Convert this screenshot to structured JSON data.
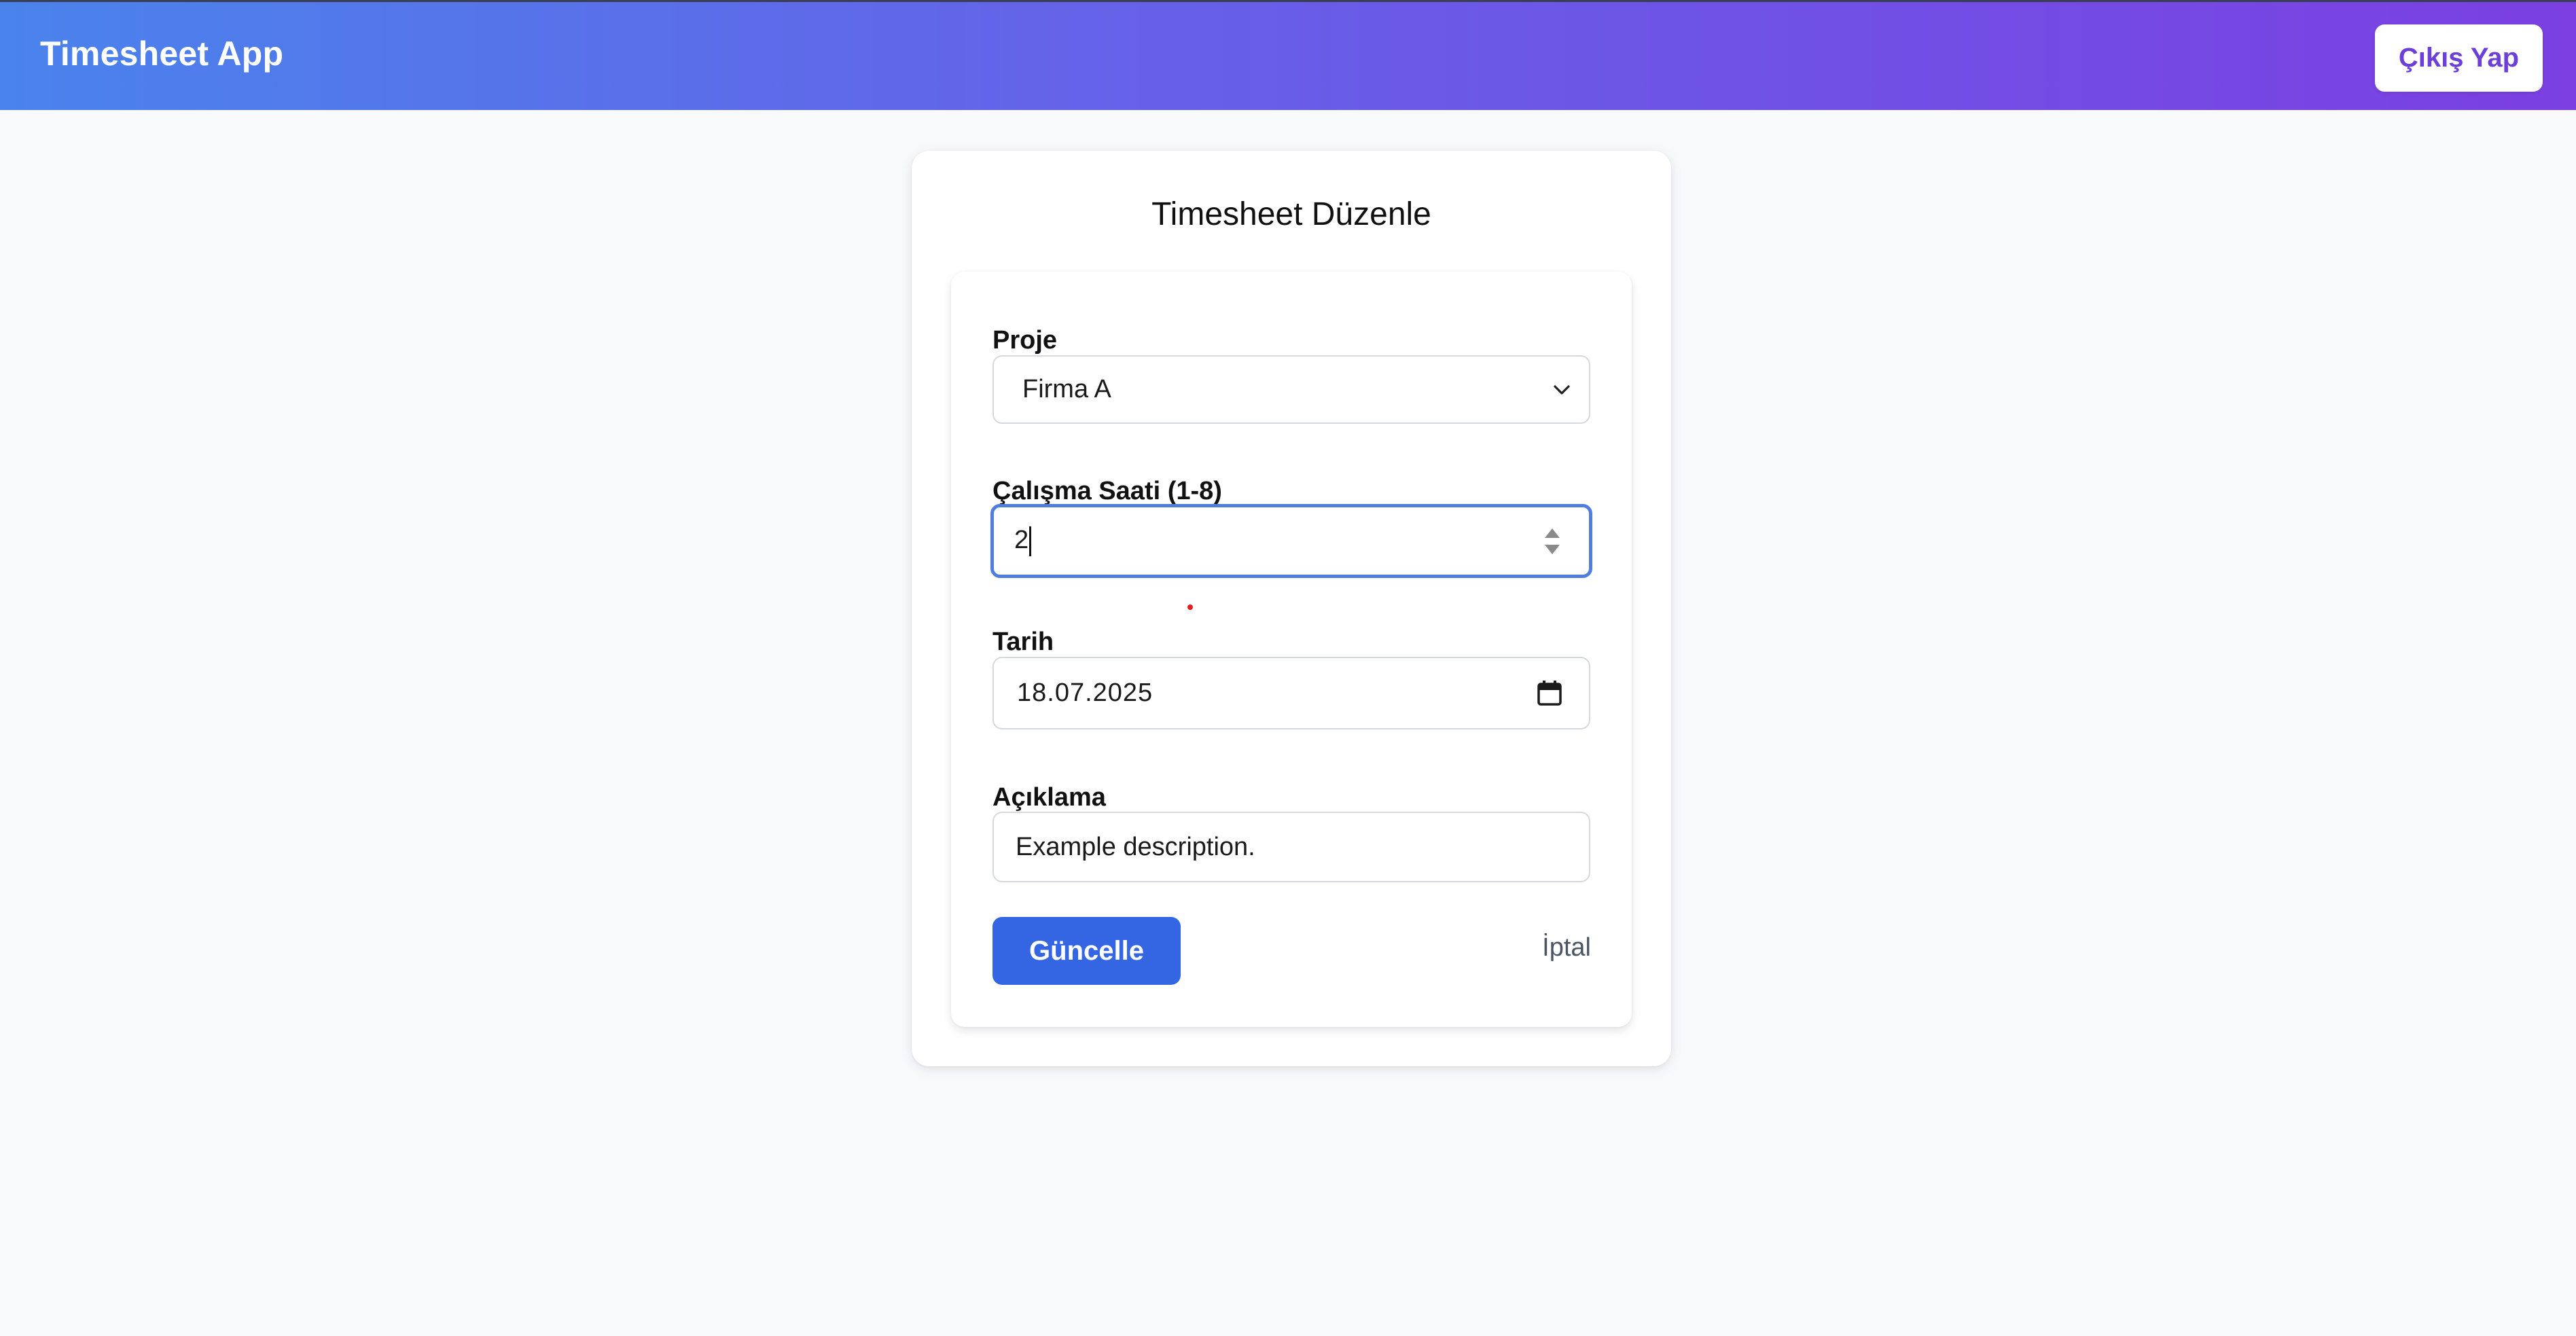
{
  "header": {
    "brand": "Timesheet App",
    "logout_label": "Çıkış Yap"
  },
  "form": {
    "title": "Timesheet Düzenle",
    "project": {
      "label": "Proje",
      "selected": "Firma A"
    },
    "hours": {
      "label": "Çalışma Saati (1-8)",
      "value": "2"
    },
    "date": {
      "label": "Tarih",
      "value": "18.07.2025"
    },
    "description": {
      "label": "Açıklama",
      "value": "Example description."
    },
    "submit_label": "Güncelle",
    "cancel_label": "İptal"
  },
  "colors": {
    "header_gradient_start": "#4a83ec",
    "header_gradient_end": "#7b3fe2",
    "primary": "#3466e4",
    "focus_border": "#4f7de0"
  }
}
